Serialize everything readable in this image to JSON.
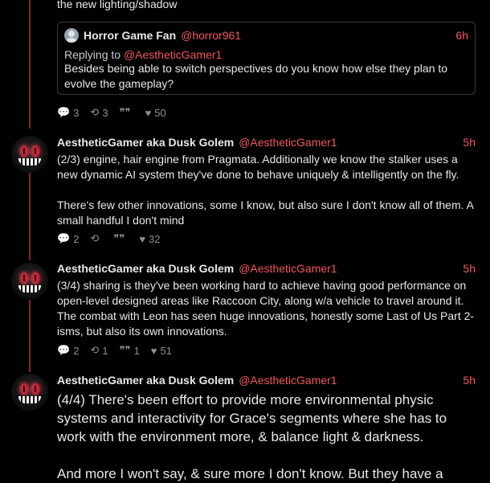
{
  "top_fragment": "the new lighting/shadow",
  "quote": {
    "name": "Horror Game Fan",
    "handle": "@horror961",
    "time": "6h",
    "replying_prefix": "Replying to ",
    "replying_handle": "@AestheticGamer1",
    "body": "Besides being able to switch perspectives do you know how else they plan to evolve the gameplay?"
  },
  "stats0": {
    "replies": "3",
    "reposts": "3",
    "quotes": "",
    "likes": "50"
  },
  "posts": [
    {
      "name": "AestheticGamer aka Dusk Golem",
      "handle": "@AestheticGamer1",
      "time": "5h",
      "body1": "(2/3) engine, hair engine from Pragmata. Additionally we know the stalker uses a new dynamic AI system they've done to behave uniquely & intelligently on the fly.",
      "body2": "There's  few other innovations, some I know, but also sure I don't know all of them. A small handful I don't mind",
      "stats": {
        "replies": "2",
        "reposts": "",
        "quotes": "",
        "likes": "32"
      }
    },
    {
      "name": "AestheticGamer aka Dusk Golem",
      "handle": "@AestheticGamer1",
      "time": "5h",
      "body1": "(3/4) sharing is they've been working hard to achieve having good performance on open-level designed areas like Raccoon City, along w/a vehicle to travel around it. The combat with Leon has seen huge innovations, honestly some Last of Us Part 2-isms, but also its own innovations.",
      "stats": {
        "replies": "2",
        "reposts": "1",
        "quotes": "1",
        "likes": "51"
      }
    },
    {
      "name": "AestheticGamer aka Dusk Golem",
      "handle": "@AestheticGamer1",
      "time": "5h",
      "body1": "(4/4) There's been effort to provide more environmental physic systems and interactivity for Grace's segments where she has to work with the environment more, & balance light & darkness.",
      "body2": "And more I won't say, & sure more I don't know. But they have a"
    }
  ],
  "icons": {
    "reply": "reply-icon",
    "repost": "repost-icon",
    "quote": "quote-icon",
    "like": "heart-icon"
  },
  "colors": {
    "accent": "#f0565a",
    "thread_line": "#7a2b2b",
    "background": "#000000"
  }
}
